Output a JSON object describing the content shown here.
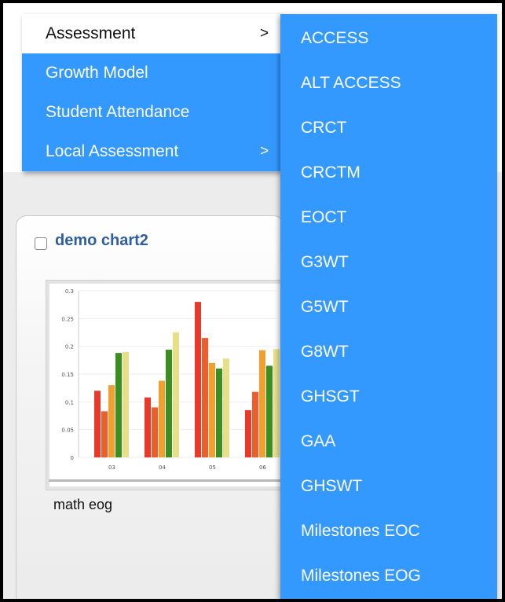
{
  "main_menu": {
    "items": [
      {
        "label": "Assessment",
        "arrow": ">"
      },
      {
        "label": "Growth Model",
        "arrow": ""
      },
      {
        "label": "Student Attendance",
        "arrow": ""
      },
      {
        "label": "Local Assessment",
        "arrow": ">"
      }
    ],
    "active_index": 0
  },
  "sub_menu": {
    "items": [
      {
        "label": "ACCESS"
      },
      {
        "label": "ALT ACCESS"
      },
      {
        "label": "CRCT"
      },
      {
        "label": "CRCTM"
      },
      {
        "label": "EOCT"
      },
      {
        "label": "G3WT"
      },
      {
        "label": "G5WT"
      },
      {
        "label": "G8WT"
      },
      {
        "label": "GHSGT"
      },
      {
        "label": "GAA"
      },
      {
        "label": "GHSWT"
      },
      {
        "label": "Milestones EOC"
      },
      {
        "label": "Milestones EOG"
      }
    ]
  },
  "card": {
    "title": "demo chart2",
    "checked": false,
    "thumbnail_label": "math eog"
  },
  "colors": {
    "menu_bg": "#3399ff",
    "menu_text": "#ffffff",
    "active_bg": "#ffffff",
    "card_title": "#2f5f9e"
  },
  "chart_data": {
    "type": "bar",
    "categories": [
      "03",
      "04",
      "05",
      "06"
    ],
    "yticks": [
      "0",
      "0.05",
      "0.1",
      "0.15",
      "0.2",
      "0.25",
      "0.3"
    ],
    "ylim": [
      0,
      0.3
    ],
    "series_colors": [
      "#e8392a",
      "#f25c2a",
      "#f0a030",
      "#3a8f1e",
      "#e6e08a"
    ],
    "series": [
      {
        "values": [
          0.12,
          0.108,
          0.28,
          0.085
        ]
      },
      {
        "values": [
          0.083,
          0.09,
          0.215,
          0.118
        ]
      },
      {
        "values": [
          0.13,
          0.138,
          0.17,
          0.193
        ]
      },
      {
        "values": [
          0.188,
          0.194,
          0.16,
          0.165
        ]
      },
      {
        "values": [
          0.19,
          0.225,
          0.178,
          0.195
        ]
      }
    ]
  }
}
